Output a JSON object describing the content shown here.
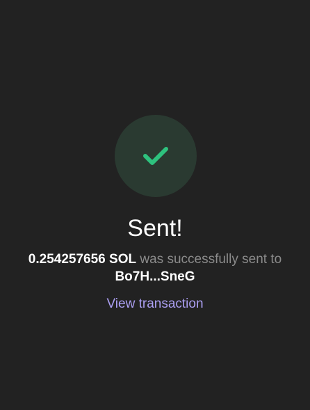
{
  "status": {
    "icon": "check-icon",
    "accent_color": "#2ec27e",
    "circle_color": "#2a3a31"
  },
  "title": "Sent!",
  "message": {
    "amount": "0.254257656 SOL",
    "middle": "was successfully sent",
    "to_word": "to",
    "recipient": "Bo7H...SneG"
  },
  "link": {
    "label": "View transaction",
    "color": "#ab9ff2"
  }
}
